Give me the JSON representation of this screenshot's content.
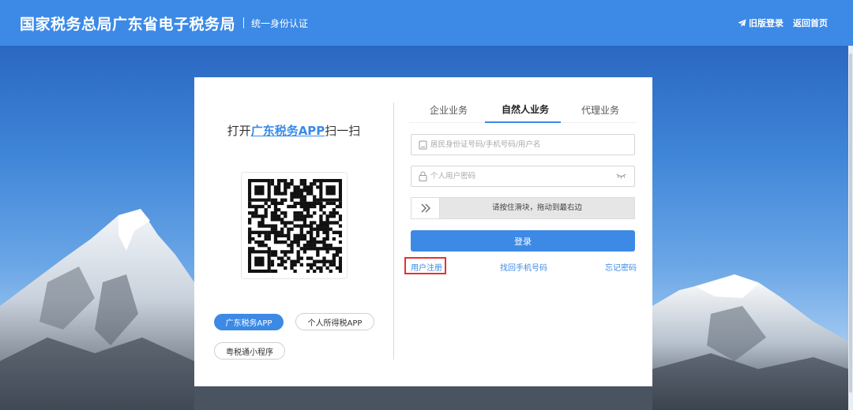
{
  "header": {
    "title": "国家税务总局广东省电子税务局",
    "subtitle": "统一身份认证",
    "nav": [
      {
        "label": "旧版登录",
        "icon": "paper-plane-icon"
      },
      {
        "label": "返回首页"
      }
    ]
  },
  "qr_panel": {
    "prefix": "打开",
    "app_name": "广东税务APP",
    "suffix": "扫一扫",
    "apps": [
      {
        "label": "广东税务APP",
        "active": true
      },
      {
        "label": "个人所得税APP",
        "active": false
      },
      {
        "label": "粤税通小程序",
        "active": false
      }
    ]
  },
  "login": {
    "tabs": [
      {
        "label": "企业业务",
        "active": false
      },
      {
        "label": "自然人业务",
        "active": true
      },
      {
        "label": "代理业务",
        "active": false
      }
    ],
    "username_placeholder": "居民身份证号码/手机号码/用户名",
    "password_placeholder": "个人用户密码",
    "slider_text": "请按住滑块，拖动到最右边",
    "submit_label": "登录",
    "links": {
      "register": "用户注册",
      "recover_phone": "找回手机号码",
      "forgot_password": "忘记密码"
    }
  },
  "colors": {
    "accent": "#3c8ae6",
    "highlight_border": "#e8322f"
  }
}
